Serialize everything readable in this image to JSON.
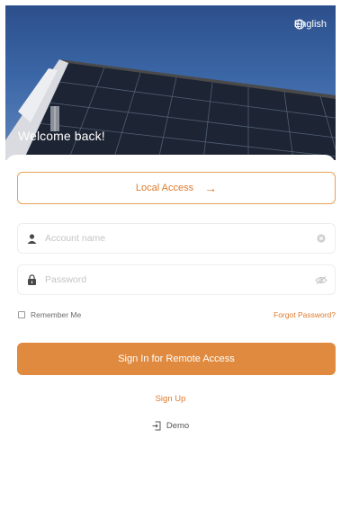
{
  "header": {
    "language_label": "English",
    "welcome_text": "Welcome back!"
  },
  "local_access": {
    "label": "Local Access",
    "arrow": "→"
  },
  "account_field": {
    "placeholder": "Account name"
  },
  "password_field": {
    "placeholder": "Password"
  },
  "remember_me": {
    "label": "Remember Me",
    "checked": false
  },
  "forgot_password": {
    "label": "Forgot Password?"
  },
  "remote_button": {
    "label": "Sign In for Remote Access"
  },
  "signup": {
    "label": "Sign Up"
  },
  "demo": {
    "label": "Demo"
  },
  "colors": {
    "accent": "#e08a3f",
    "accent_text": "#e07a2c",
    "sky": "#3b66a6"
  },
  "icons": {
    "language": "globe-icon",
    "arrow": "arrow-right-icon",
    "account": "user-icon",
    "clear": "clear-icon",
    "password": "lock-icon",
    "visibility": "eye-icon",
    "demo": "login-icon"
  }
}
